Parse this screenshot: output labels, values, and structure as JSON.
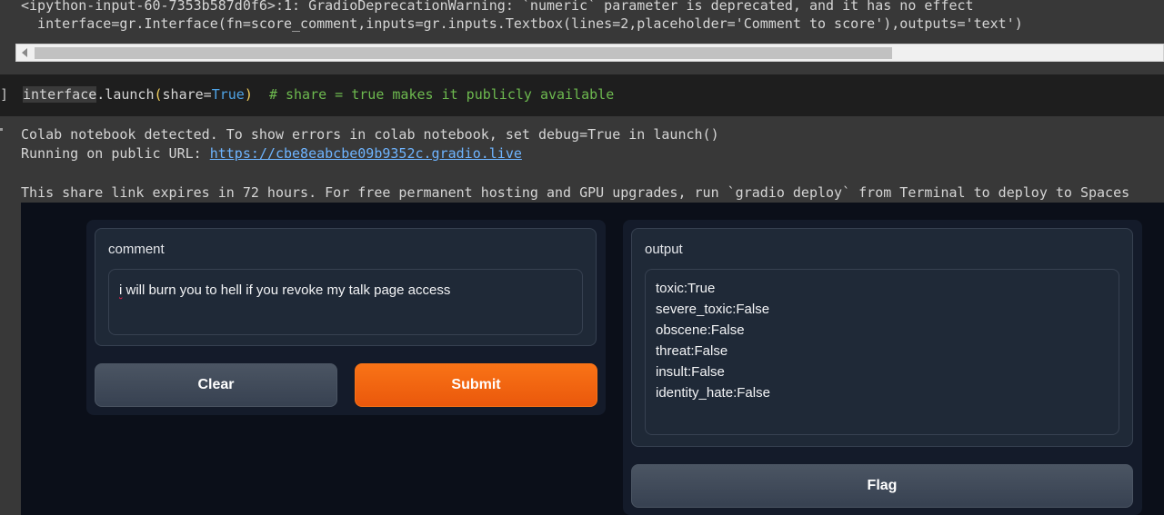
{
  "warning": {
    "line1": "<ipython-input-60-7353b587d0f6>:1: GradioDeprecationWarning: `numeric` parameter is deprecated, and it has no effect",
    "line2": "  interface=gr.Interface(fn=score_comment,inputs=gr.inputs.Textbox(lines=2,placeholder='Comment to score'),outputs='text')"
  },
  "code_cell": {
    "bracket": "]",
    "tokens": {
      "obj": "interface",
      "dot_method": ".launch",
      "open_paren": "(",
      "arg_name": "share=",
      "arg_value": "True",
      "close_paren": ")",
      "comment": "# share = true makes it publicly available"
    }
  },
  "output": {
    "line1": "Colab notebook detected. To show errors in colab notebook, set debug=True in launch()",
    "line2_prefix": "Running on public URL: ",
    "public_url": "https://cbe8eabcbe09b9352c.gradio.live",
    "line3": "This share link expires in 72 hours. For free permanent hosting and GPU upgrades, run `gradio deploy` from Terminal to deploy to Spaces"
  },
  "gradio": {
    "input_label": "comment",
    "input_value_first": "i",
    "input_value_rest": " will burn you to hell if you revoke my talk page access",
    "clear_label": "Clear",
    "submit_label": "Submit",
    "output_label": "output",
    "output_lines": [
      "toxic:True",
      "severe_toxic:False",
      "obscene:False",
      "threat:False",
      "insult:False",
      "identity_hate:False"
    ],
    "flag_label": "Flag",
    "colors": {
      "primary": "#f97316",
      "background": "#0b0f19",
      "block": "#1f2937"
    }
  }
}
